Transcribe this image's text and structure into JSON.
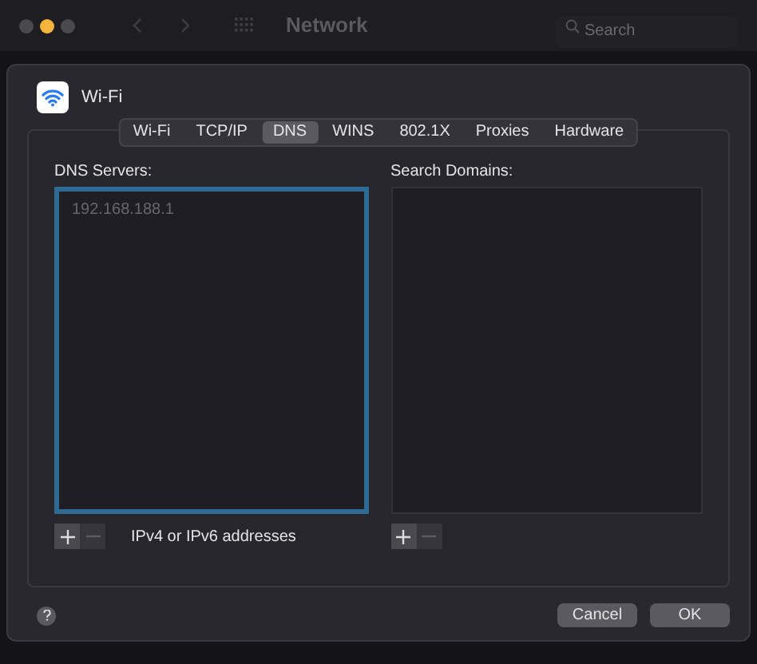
{
  "window": {
    "title": "Network",
    "controls": [
      {
        "color": "#4a494e"
      },
      {
        "color": "#f6b53a"
      },
      {
        "color": "#4a494e"
      }
    ],
    "search": {
      "placeholder": "Search"
    }
  },
  "sheet": {
    "service": "Wi-Fi",
    "tabs": [
      {
        "label": "Wi-Fi",
        "selected": false
      },
      {
        "label": "TCP/IP",
        "selected": false
      },
      {
        "label": "DNS",
        "selected": true
      },
      {
        "label": "WINS",
        "selected": false
      },
      {
        "label": "802.1X",
        "selected": false
      },
      {
        "label": "Proxies",
        "selected": false
      },
      {
        "label": "Hardware",
        "selected": false
      }
    ],
    "dns_servers": {
      "label": "DNS Servers:",
      "focused": true,
      "entries": [
        "192.168.188.1"
      ],
      "remove_disabled": true,
      "hint": "IPv4 or IPv6 addresses"
    },
    "search_domains": {
      "label": "Search Domains:",
      "focused": false,
      "remove_disabled": true
    },
    "buttons": [
      "Cancel",
      "OK"
    ]
  }
}
